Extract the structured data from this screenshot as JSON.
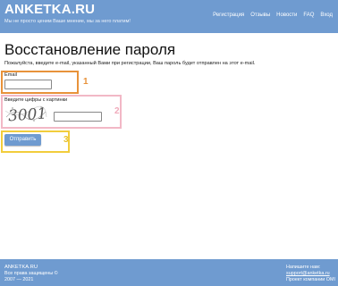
{
  "header": {
    "logo": "ANKETKA.RU",
    "tagline": "Мы не просто ценим Ваше мнение, мы за него платим!",
    "nav": [
      "Регистрация",
      "Отзывы",
      "Новости",
      "FAQ",
      "Вход"
    ]
  },
  "main": {
    "title": "Восстановление пароля",
    "intro": "Пожалуйста, введите e-mail, указанный Вами при регистрации, Ваш пароль будет отправлен на этот e-mail.",
    "email_label": "Email",
    "email_value": "",
    "captcha_label": "Введите цифры с картинки",
    "captcha_text": "3001",
    "captcha_value": "",
    "submit_label": "Отправить",
    "markers": [
      "1",
      "2",
      "3"
    ]
  },
  "colors": {
    "header_bg": "#6f9bd0",
    "marker1": "#e8923a",
    "marker2": "#f2b8c6",
    "marker3": "#f2cd3c"
  },
  "footer": {
    "brand": "ANKETKA.RU",
    "rights": "Все права защищены ©",
    "years": "2007 — 2021",
    "contact_label": "Напишите нам:",
    "contact_email": "support@anketka.ru",
    "company": "Проект компании OMI"
  }
}
